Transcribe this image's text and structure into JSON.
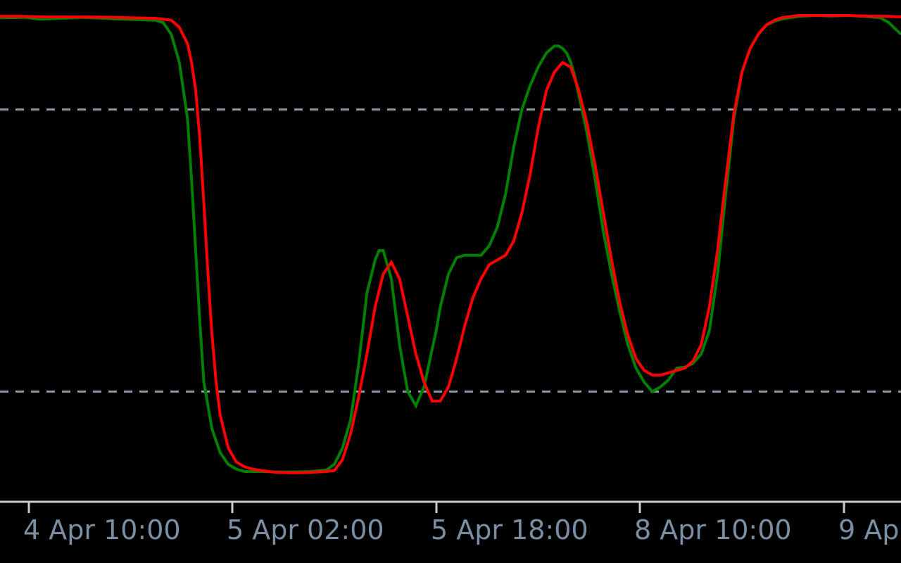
{
  "chart_data": {
    "type": "line",
    "title": "",
    "xlabel": "",
    "ylabel": "",
    "ylim": [
      0,
      100
    ],
    "xlim": [
      0,
      221
    ],
    "grid": false,
    "levels": [
      {
        "value": 80,
        "style": "dashed"
      },
      {
        "value": 20,
        "style": "dashed"
      }
    ],
    "x_ticks": [
      {
        "x": 7,
        "label": "4 Apr 10:00"
      },
      {
        "x": 57,
        "label": "5 Apr 02:00"
      },
      {
        "x": 107,
        "label": "5 Apr 18:00"
      },
      {
        "x": 157,
        "label": "8 Apr 10:00"
      },
      {
        "x": 207,
        "label": "9 Ap"
      }
    ],
    "series": [
      {
        "color": "#008000",
        "x": [
          0,
          6,
          10,
          20,
          28,
          38,
          40,
          42,
          44,
          46,
          47,
          48,
          49,
          50,
          52,
          54,
          56,
          58,
          60,
          62,
          64,
          68,
          72,
          76,
          80,
          82,
          84,
          86,
          88,
          90,
          92,
          93,
          94,
          96,
          98,
          100,
          102,
          104,
          106,
          107,
          108,
          110,
          112,
          114,
          116,
          118,
          120,
          122,
          124,
          126,
          128,
          130,
          132,
          134,
          136,
          137,
          138,
          139,
          140,
          141,
          142,
          144,
          146,
          148,
          150,
          152,
          154,
          156,
          158,
          160,
          162,
          164,
          166,
          168,
          170,
          172,
          174,
          176,
          178,
          180,
          182,
          184,
          186,
          188,
          190,
          192,
          196,
          200,
          204,
          208,
          212,
          216,
          218,
          221
        ],
        "y": [
          99.5,
          99.6,
          99.2,
          99.6,
          99.3,
          99.0,
          98.5,
          96.0,
          90.0,
          78.0,
          65.0,
          50.0,
          35.0,
          22.0,
          12.0,
          7.0,
          4.5,
          3.5,
          3.0,
          3.0,
          3.0,
          2.9,
          2.9,
          3.0,
          3.3,
          4.5,
          8.0,
          14.0,
          26.0,
          41.0,
          48.0,
          50.0,
          50.0,
          44.0,
          30.0,
          20.0,
          17.0,
          21.0,
          29.0,
          33.0,
          38.0,
          45.0,
          48.5,
          49.0,
          49.0,
          49.0,
          51.0,
          55.0,
          62.0,
          72.0,
          80.0,
          85.0,
          89.0,
          92.0,
          93.5,
          93.5,
          93.0,
          92.0,
          90.0,
          87.0,
          83.0,
          75.0,
          65.0,
          54.0,
          45.0,
          37.0,
          30.0,
          25.0,
          22.0,
          20.0,
          21.0,
          22.5,
          25.0,
          25.2,
          26.0,
          28.0,
          33.0,
          45.0,
          62.0,
          78.0,
          88.0,
          93.0,
          96.0,
          98.0,
          98.8,
          99.3,
          99.8,
          100.0,
          99.9,
          100.0,
          99.8,
          99.5,
          98.5,
          96.0
        ]
      },
      {
        "color": "#ff0000",
        "x": [
          0,
          6,
          10,
          20,
          28,
          38,
          40,
          42,
          44,
          46,
          47,
          48,
          49,
          50,
          51,
          52,
          53,
          54,
          56,
          58,
          60,
          62,
          64,
          68,
          72,
          76,
          80,
          82,
          84,
          86,
          88,
          90,
          92,
          94,
          96,
          98,
          100,
          102,
          104,
          106,
          108,
          110,
          112,
          114,
          116,
          118,
          120,
          122,
          124,
          126,
          128,
          130,
          132,
          134,
          136,
          138,
          140,
          142,
          144,
          146,
          148,
          150,
          152,
          154,
          156,
          158,
          160,
          162,
          164,
          166,
          168,
          170,
          172,
          174,
          176,
          178,
          180,
          182,
          184,
          186,
          188,
          190,
          192,
          196,
          200,
          204,
          208,
          212,
          216,
          218,
          221
        ],
        "y": [
          99.8,
          99.8,
          99.7,
          99.7,
          99.6,
          99.4,
          99.2,
          99.0,
          97.5,
          94.0,
          90.0,
          84.0,
          74.0,
          60.0,
          45.0,
          32.0,
          22.0,
          15.0,
          8.0,
          5.0,
          4.0,
          3.5,
          3.2,
          2.8,
          2.7,
          2.8,
          3.0,
          3.2,
          5.5,
          11.0,
          19.0,
          28.0,
          38.0,
          45.0,
          47.5,
          44.0,
          36.0,
          28.0,
          22.0,
          18.0,
          18.0,
          21.0,
          27.0,
          34.0,
          40.0,
          44.0,
          47.0,
          48.0,
          49.0,
          52.0,
          58.0,
          66.0,
          76.0,
          84.0,
          88.0,
          90.0,
          89.0,
          84.0,
          77.0,
          68.0,
          58.0,
          48.0,
          39.0,
          32.0,
          27.0,
          24.5,
          23.5,
          23.5,
          24.0,
          24.5,
          25.0,
          26.5,
          30.0,
          38.0,
          50.0,
          65.0,
          79.0,
          88.0,
          93.0,
          96.0,
          98.0,
          99.0,
          99.6,
          100.0,
          100.0,
          100.0,
          100.0,
          99.9,
          99.8,
          99.8,
          99.7
        ]
      }
    ]
  }
}
